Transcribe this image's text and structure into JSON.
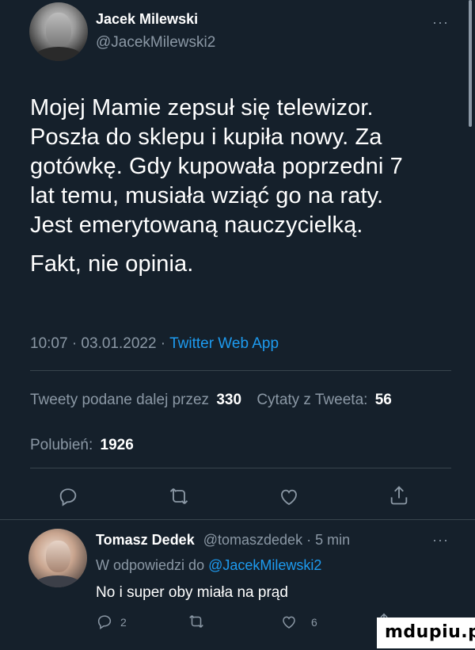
{
  "tweet": {
    "author_name": "Jacek Milewski",
    "author_handle": "@JacekMilewski2",
    "more": "···",
    "text_lines": [
      "Mojej Mamie zepsuł się telewizor.",
      "Poszła do sklepu i kupiła nowy. Za",
      "gotówkę. Gdy kupowała poprzedni 7",
      "lat temu, musiała wziąć go na raty.",
      "Jest emerytowaną nauczycielką."
    ],
    "text_last": "Fakt, nie opinia.",
    "time": "10:07 · 03.01.2022 · ",
    "source": "Twitter Web App",
    "stats": {
      "retweets_label": "Tweety podane dalej przez",
      "retweets_count": "330",
      "quotes_label": "Cytaty z Tweeta:",
      "quotes_count": "56",
      "likes_label": "Polubień:",
      "likes_count": "1926"
    }
  },
  "actions": [
    "reply-icon",
    "retweet-icon",
    "like-icon",
    "share-icon"
  ],
  "reply": {
    "author_name": "Tomasz Dedek",
    "author_handle_time": "@tomaszdedek · 5 min",
    "more": "···",
    "in_reply_prefix": "W odpowiedzi do ",
    "in_reply_handle": "@JacekMilewski2",
    "text": "No i super oby miała na prąd",
    "reply_count": "2",
    "like_count": "6"
  },
  "watermark": "mdupiu.pl",
  "colors": {
    "background": "#15202b",
    "text": "#ffffff",
    "muted": "#8b98a5",
    "link": "#1d9bf0",
    "divider": "#38444d"
  }
}
